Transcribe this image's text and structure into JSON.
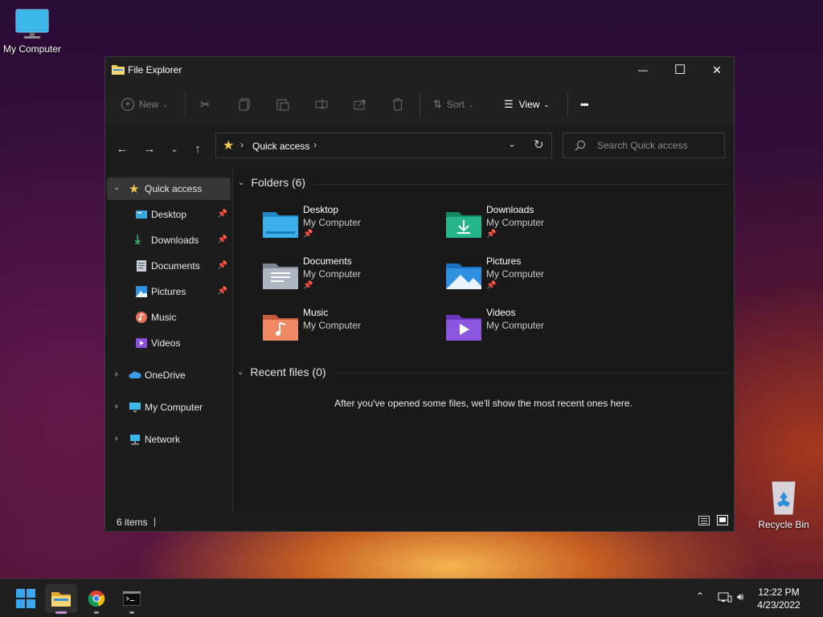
{
  "desktop": {
    "icons": [
      {
        "label": "My Computer"
      },
      {
        "label": "Recycle Bin"
      }
    ]
  },
  "window": {
    "title": "File Explorer",
    "controls": {
      "minimize": "—",
      "maximize": "☐",
      "close": "✕"
    }
  },
  "commandbar": {
    "new_label": "New",
    "sort_label": "Sort",
    "view_label": "View",
    "more_label": "•••"
  },
  "address": {
    "path": [
      "Quick access"
    ],
    "search_placeholder": "Search Quick access"
  },
  "sidebar": {
    "items": [
      {
        "label": "Quick access",
        "icon": "star-icon"
      },
      {
        "label": "Desktop",
        "icon": "desktop-folder-icon",
        "pinned": true
      },
      {
        "label": "Downloads",
        "icon": "download-icon",
        "pinned": true
      },
      {
        "label": "Documents",
        "icon": "documents-icon",
        "pinned": true
      },
      {
        "label": "Pictures",
        "icon": "pictures-icon",
        "pinned": true
      },
      {
        "label": "Music",
        "icon": "music-icon"
      },
      {
        "label": "Videos",
        "icon": "videos-icon"
      },
      {
        "label": "OneDrive",
        "icon": "cloud-icon"
      },
      {
        "label": "My Computer",
        "icon": "computer-icon"
      },
      {
        "label": "Network",
        "icon": "network-icon"
      }
    ]
  },
  "main": {
    "folders_header": "Folders (6)",
    "recent_header": "Recent files (0)",
    "folders": [
      {
        "name": "Desktop",
        "location": "My Computer",
        "pinned": true
      },
      {
        "name": "Downloads",
        "location": "My Computer",
        "pinned": true
      },
      {
        "name": "Documents",
        "location": "My Computer",
        "pinned": true
      },
      {
        "name": "Pictures",
        "location": "My Computer",
        "pinned": true
      },
      {
        "name": "Music",
        "location": "My Computer",
        "pinned": false
      },
      {
        "name": "Videos",
        "location": "My Computer",
        "pinned": false
      }
    ],
    "recent_empty_text": "After you've opened some files, we'll show the most recent ones here."
  },
  "status": {
    "items_text": "6 items",
    "separator": "|"
  },
  "taskbar": {
    "clock_time": "12:22 PM",
    "clock_date": "4/23/2022"
  },
  "colors": {
    "accent": "#4cc2ff",
    "folder_yellow": "#f2c94c",
    "window_bg": "#1c1c1c"
  }
}
